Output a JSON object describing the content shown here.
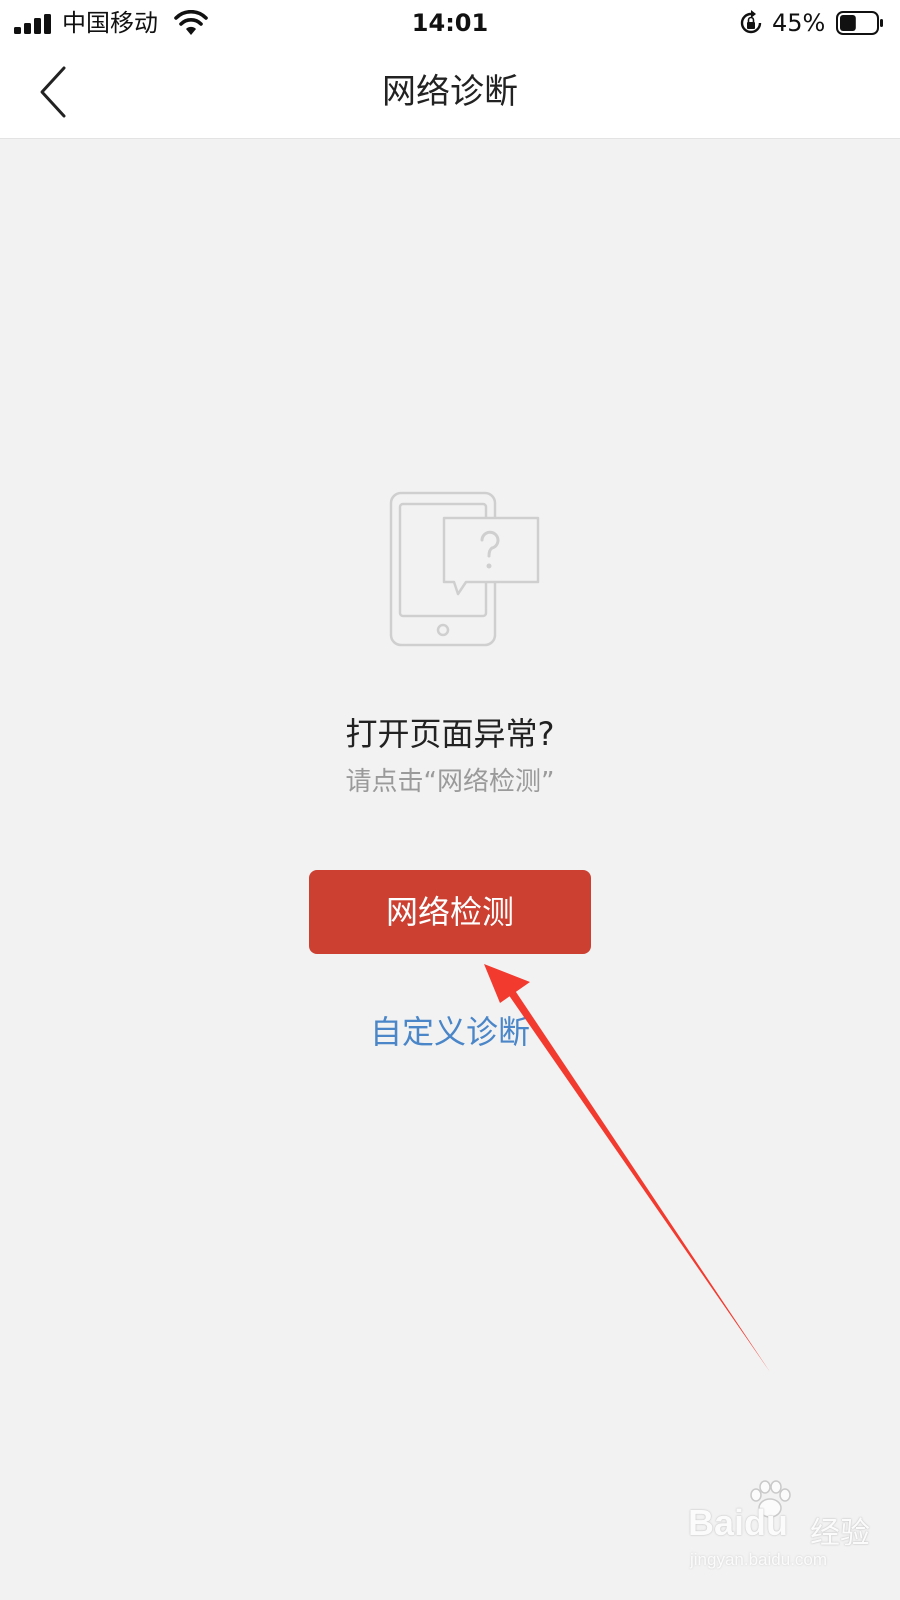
{
  "status_bar": {
    "carrier": "中国移动",
    "time": "14:01",
    "battery_percent": "45%",
    "battery_level": 0.45,
    "icons": [
      "signal-icon",
      "wifi-icon",
      "rotation-lock-icon",
      "battery-icon"
    ]
  },
  "nav": {
    "title": "网络诊断",
    "back_icon": "chevron-left-icon"
  },
  "main": {
    "illustration_icon": "phone-question-icon",
    "headline": "打开页面异常?",
    "subline": "请点击“网络检测”",
    "primary_button_label": "网络检测",
    "link_label": "自定义诊断"
  },
  "annotation": {
    "arrow_color": "#f23a2f"
  },
  "watermark": {
    "logo": "Baidu",
    "product": "经验",
    "url": "jingyan.baidu.com"
  },
  "colors": {
    "background": "#f2f2f2",
    "primary_button": "#cc4032",
    "link": "#4a86c8",
    "muted_text": "#9a9a9a"
  }
}
